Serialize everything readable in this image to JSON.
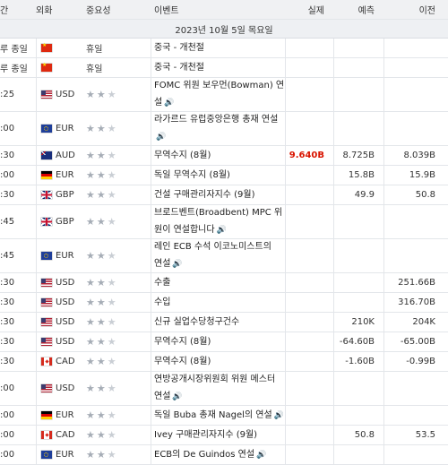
{
  "header": {
    "time": "간",
    "currency": "외화",
    "importance": "중요성",
    "event": "이벤트",
    "actual": "실제",
    "forecast": "예측",
    "previous": "이전"
  },
  "date_label": "2023년 10월 5일 목요일",
  "rows": [
    {
      "time": "루 종일",
      "flag": "cn",
      "currency": "",
      "stars": 0,
      "tag": "휴일",
      "event": [
        "중국 - 개천절"
      ],
      "speaker": false,
      "actual": "",
      "forecast": "",
      "previous": ""
    },
    {
      "time": "루 종일",
      "flag": "cn",
      "currency": "",
      "stars": 0,
      "tag": "휴일",
      "event": [
        "중국 - 개천절"
      ],
      "speaker": false,
      "actual": "",
      "forecast": "",
      "previous": ""
    },
    {
      "time": ":25",
      "flag": "us",
      "currency": "USD",
      "stars": 2,
      "event": [
        "FOMC 위원 보우먼(Bowman) 연",
        "설"
      ],
      "speaker": true,
      "actual": "",
      "forecast": "",
      "previous": ""
    },
    {
      "time": ":00",
      "flag": "eu",
      "currency": "EUR",
      "stars": 2,
      "event": [
        "라가르드 유럽중앙은행 총재 연설",
        ""
      ],
      "speaker": true,
      "actual": "",
      "forecast": "",
      "previous": ""
    },
    {
      "time": ":30",
      "flag": "au",
      "currency": "AUD",
      "stars": 2,
      "event": [
        "무역수지 (8월)"
      ],
      "speaker": false,
      "actual": "9.640B",
      "actual_red": true,
      "forecast": "8.725B",
      "previous": "8.039B"
    },
    {
      "time": ":00",
      "flag": "de",
      "currency": "EUR",
      "stars": 2,
      "event": [
        "독일 무역수지 (8월)"
      ],
      "speaker": false,
      "actual": "",
      "forecast": "15.8B",
      "previous": "15.9B"
    },
    {
      "time": ":30",
      "flag": "gb",
      "currency": "GBP",
      "stars": 2,
      "event": [
        "건설 구매관리자지수 (9월)"
      ],
      "speaker": false,
      "actual": "",
      "forecast": "49.9",
      "previous": "50.8"
    },
    {
      "time": ":45",
      "flag": "gb",
      "currency": "GBP",
      "stars": 2,
      "event": [
        "브로드벤트(Broadbent) MPC 위",
        "원이 연설합니다"
      ],
      "speaker": true,
      "actual": "",
      "forecast": "",
      "previous": ""
    },
    {
      "time": ":45",
      "flag": "eu",
      "currency": "EUR",
      "stars": 2,
      "event": [
        "레인 ECB 수석 이코노미스트의",
        "연설"
      ],
      "speaker": true,
      "actual": "",
      "forecast": "",
      "previous": ""
    },
    {
      "time": ":30",
      "flag": "us",
      "currency": "USD",
      "stars": 2,
      "event": [
        "수출"
      ],
      "speaker": false,
      "actual": "",
      "forecast": "",
      "previous": "251.66B"
    },
    {
      "time": ":30",
      "flag": "us",
      "currency": "USD",
      "stars": 2,
      "event": [
        "수입"
      ],
      "speaker": false,
      "actual": "",
      "forecast": "",
      "previous": "316.70B"
    },
    {
      "time": ":30",
      "flag": "us",
      "currency": "USD",
      "stars": 2,
      "event": [
        "신규 실업수당청구건수"
      ],
      "speaker": false,
      "actual": "",
      "forecast": "210K",
      "previous": "204K"
    },
    {
      "time": ":30",
      "flag": "us",
      "currency": "USD",
      "stars": 2,
      "event": [
        "무역수지 (8월)"
      ],
      "speaker": false,
      "actual": "",
      "forecast": "-64.60B",
      "previous": "-65.00B"
    },
    {
      "time": ":30",
      "flag": "ca",
      "currency": "CAD",
      "stars": 2,
      "event": [
        "무역수지 (8월)"
      ],
      "speaker": false,
      "actual": "",
      "forecast": "-1.60B",
      "previous": "-0.99B"
    },
    {
      "time": ":00",
      "flag": "us",
      "currency": "USD",
      "stars": 2,
      "event": [
        "연방공개시장위원회 위원 메스터",
        "연설"
      ],
      "speaker": true,
      "actual": "",
      "forecast": "",
      "previous": ""
    },
    {
      "time": ":00",
      "flag": "de",
      "currency": "EUR",
      "stars": 2,
      "event": [
        "독일 Buba 총재 Nagel의 연설"
      ],
      "speaker": true,
      "actual": "",
      "forecast": "",
      "previous": ""
    },
    {
      "time": ":00",
      "flag": "ca",
      "currency": "CAD",
      "stars": 2,
      "event": [
        "Ivey 구매관리자지수 (9월)"
      ],
      "speaker": false,
      "actual": "",
      "forecast": "50.8",
      "previous": "53.5"
    },
    {
      "time": ":00",
      "flag": "eu",
      "currency": "EUR",
      "stars": 2,
      "event": [
        "ECB의 De Guindos 연설"
      ],
      "speaker": true,
      "actual": "",
      "forecast": "",
      "previous": ""
    }
  ]
}
